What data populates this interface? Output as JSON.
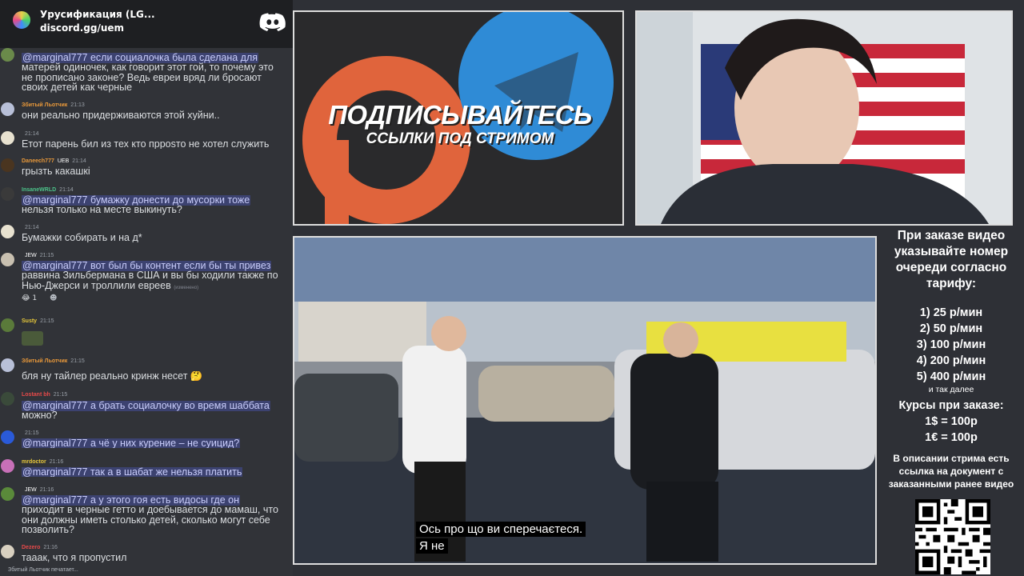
{
  "server": {
    "name": "Урусификация (LG...",
    "invite": "discord.gg/uem"
  },
  "messages": [
    {
      "author": "",
      "time": "",
      "lines": [
        "@marginal777 если социалочка была сделана для",
        "матерей одиночек, как говорит этот гой, то почему это",
        "не прописано законе? Ведь евреи вряд ли бросают",
        "своих детей как черные"
      ]
    },
    {
      "author": "Збитый Льотчик",
      "time": "21:13",
      "lines": [
        "они реально придерживаются этой хуйни.."
      ]
    },
    {
      "author": "",
      "time": "21:14",
      "lines": [
        "Етот парень бил из тех кто пррosто не хотел служить"
      ]
    },
    {
      "author": "Daneech777",
      "time": "21:14",
      "badge": "UEB",
      "lines": [
        "грызть какашкі"
      ]
    },
    {
      "author": "InsaneWRLD",
      "time": "21:14",
      "lines": [
        "@marginal777 бумажку донести до мусорки тоже",
        "нельзя только на месте выкинуть?"
      ]
    },
    {
      "author": "",
      "time": "21:14",
      "lines": [
        "Бумажки собирать и на  д*"
      ]
    },
    {
      "author": "",
      "time": "21:15",
      "badge": "JEW",
      "lines": [
        "@marginal777 вот был бы контент если бы ты привез",
        "раввина Зильбермана в США и вы бы ходили также по",
        "Нью-Джерси и троллили евреев"
      ],
      "edited": "(изменено)",
      "reaction": "😂 1"
    },
    {
      "author": "Susty",
      "time": "21:15",
      "lines": [
        ""
      ]
    },
    {
      "author": "Збитый Льотчик",
      "time": "21:15",
      "lines": [
        "бля ну тайлер реально кринж несет 🤔"
      ]
    },
    {
      "author": "Lostant bh",
      "time": "21:15",
      "lines": [
        "@marginal777 а брать социалочку во время шаббата",
        "можно?"
      ]
    },
    {
      "author": "",
      "time": "21:15",
      "lines": [
        "@marginal777 а чё у них курение – не суицид?"
      ]
    },
    {
      "author": "mrdoctor",
      "time": "21:16",
      "lines": [
        "@marginal777 так а в шабат же нельзя платить"
      ]
    },
    {
      "author": "",
      "time": "21:16",
      "badge": "JEW",
      "lines": [
        "@marginal777 а у этого гоя есть видосы где он",
        "приходит в черные гетто и доебывается до мамаш, что",
        "они должны иметь столько детей, сколько могут себе",
        "позволить?"
      ]
    },
    {
      "author": "Dezero",
      "time": "21:16",
      "lines": [
        "тааак, что я пропустил"
      ]
    }
  ],
  "typing": "Збитый Льотчик печатает...",
  "promo": {
    "title": "ПОДПИСЫВАЙТЕСЬ",
    "subtitle": "ССЫЛКИ ПОД СТРИМОМ"
  },
  "video": {
    "subtitle_lines": [
      "Ось про що ви сперечаєтеся.",
      "Я не"
    ]
  },
  "info": {
    "order_heading": "При заказе видео указывайте номер очереди согласно тарифу:",
    "tariffs": [
      "1) 25 р/мин",
      "2) 50 р/мин",
      "3) 100 р/мин",
      "4) 200 р/мин",
      "5) 400 р/мин"
    ],
    "etc": "и так далее",
    "rates_heading": "Курсы при заказе:",
    "rates": [
      "1$ = 100р",
      "1€ = 100р"
    ],
    "description": "В описании стрима есть ссылка на документ с заказанными ранее видео"
  },
  "colors": {
    "chat_bg": "#313338",
    "mention_bg": "#3c4270",
    "telegram_blue": "#2f8bd6",
    "patreon_orange": "#e0643c"
  }
}
